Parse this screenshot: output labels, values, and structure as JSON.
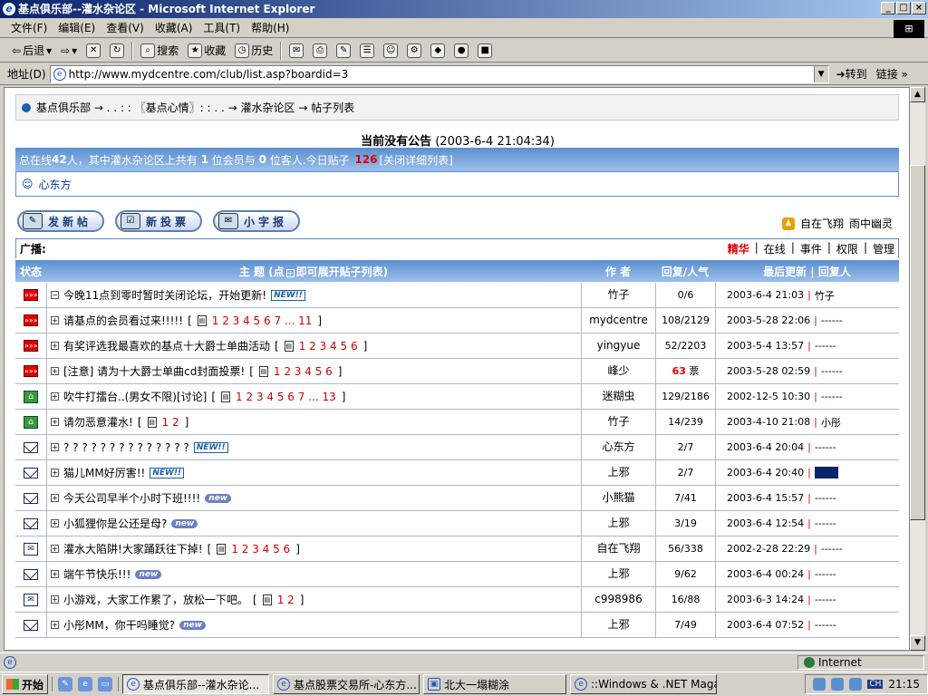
{
  "window": {
    "title": "基点俱乐部--灌水杂论区 - Microsoft Internet Explorer",
    "minimize": "_",
    "maximize": "□",
    "close": "×"
  },
  "menu": [
    "文件(F)",
    "编辑(E)",
    "查看(V)",
    "收藏(A)",
    "工具(T)",
    "帮助(H)"
  ],
  "toolbar": {
    "back": "后退",
    "search": "搜索",
    "favorites": "收藏",
    "history": "历史"
  },
  "address": {
    "label": "地址(D)",
    "url": "http://www.mydcentre.com/club/list.asp?boardid=3",
    "go": "转到",
    "links": "链接"
  },
  "breadcrumb": {
    "text": "基点俱乐部 → . . : : 〖基点心情〗: : . . → 灌水杂论区 → 帖子列表"
  },
  "notice": {
    "title": "当前没有公告",
    "time": "(2003-6-4 21:04:34)"
  },
  "stats": {
    "prefix": "总在线",
    "online": "42",
    "mid1": "人，其中灌水杂论区上共有",
    "members": "1",
    "mid2": "位会员与",
    "guests": "0",
    "mid3": "位客人.今日贴子",
    "today": "126",
    "link": "[关闭详细列表]"
  },
  "online_user": "心东方",
  "buttons": {
    "post": "发新帖",
    "vote": "新投票",
    "note": "小字报"
  },
  "friends": {
    "a": "自在飞翔",
    "b": "雨中幽灵"
  },
  "ad": {
    "label": "广播:",
    "jinghua": "精华",
    "online": "在线",
    "event": "事件",
    "perm": "权限",
    "manage": "管理"
  },
  "table_header": {
    "status": "状态",
    "topic": "主 题 (点",
    "topic2": "即可展开贴子列表)",
    "author": "作 者",
    "replies": "回复/人气",
    "last": "最后更新 | 回复人"
  },
  "threads": [
    {
      "icon": "hot",
      "sign": "⊟",
      "title": "今晚11点到零时暂时关闭论坛，开始更新!",
      "badge": "NEW!!",
      "badgeType": "new1",
      "pages": "",
      "author": "竹子",
      "replies": "0/6",
      "votes": "",
      "last": "2003-6-4 21:03",
      "replier": "竹子"
    },
    {
      "icon": "hot",
      "sign": "⊞",
      "title": "请基点的会员看过来!!!!!",
      "badge": "",
      "badgeType": "",
      "pages": "1 2 3 4 5 6 7 ... 11",
      "author": "mydcentre",
      "replies": "108/2129",
      "votes": "",
      "last": "2003-5-28 22:06",
      "replier": "------"
    },
    {
      "icon": "hot",
      "sign": "⊞",
      "title": "有奖评选我最喜欢的基点十大爵士单曲活动",
      "badge": "",
      "badgeType": "",
      "pages": "1 2 3 4 5 6",
      "author": "yingyue",
      "replies": "52/2203",
      "votes": "",
      "last": "2003-5-4 13:57",
      "replier": "------"
    },
    {
      "icon": "hot",
      "sign": "⊞",
      "title": "[注意] 请为十大爵士单曲cd封面投票!",
      "badge": "",
      "badgeType": "",
      "pages": "1 2 3 4 5 6",
      "author": "峰少",
      "replies": "63",
      "votes": "票",
      "last": "2003-5-28 02:59",
      "replier": "------"
    },
    {
      "icon": "lock",
      "sign": "⊞",
      "title": "吹牛打擂台..(男女不限)[讨论]",
      "badge": "",
      "badgeType": "",
      "pages": "1 2 3 4 5 6 7 ... 13",
      "author": "迷糊虫",
      "replies": "129/2186",
      "votes": "",
      "last": "2002-12-5 10:30",
      "replier": "------"
    },
    {
      "icon": "lock",
      "sign": "⊞",
      "title": "请勿恶意灌水!",
      "badge": "",
      "badgeType": "",
      "pages": "1 2",
      "author": "竹子",
      "replies": "14/239",
      "votes": "",
      "last": "2003-4-10 21:08",
      "replier": "小彤"
    },
    {
      "icon": "mail",
      "sign": "⊞",
      "title": "? ? ? ? ? ? ? ? ? ? ? ? ? ?",
      "badge": "NEW!!",
      "badgeType": "new1",
      "pages": "",
      "author": "心东方",
      "replies": "2/7",
      "votes": "",
      "last": "2003-6-4 20:04",
      "replier": "------"
    },
    {
      "icon": "mail",
      "sign": "⊞",
      "title": "猫儿MM好厉害!!",
      "badge": "NEW!!",
      "badgeType": "new1",
      "pages": "",
      "author": "上邪",
      "replies": "2/7",
      "votes": "",
      "last": "2003-6-4 20:40",
      "replier": "------",
      "highlight": true
    },
    {
      "icon": "mail",
      "sign": "⊞",
      "title": "今天公司早半个小时下班!!!!",
      "badge": "new",
      "badgeType": "new2",
      "pages": "",
      "author": "小熊猫",
      "replies": "7/41",
      "votes": "",
      "last": "2003-6-4 15:57",
      "replier": "------"
    },
    {
      "icon": "mail",
      "sign": "⊞",
      "title": "小狐狸你是公还是母?",
      "badge": "new",
      "badgeType": "new2",
      "pages": "",
      "author": "上邪",
      "replies": "3/19",
      "votes": "",
      "last": "2003-6-4 12:54",
      "replier": "------"
    },
    {
      "icon": "open",
      "sign": "⊞",
      "title": "灌水大陷阱!大家踊跃往下掉!",
      "badge": "",
      "badgeType": "",
      "pages": "1 2 3 4 5 6",
      "author": "自在飞翔",
      "replies": "56/338",
      "votes": "",
      "last": "2002-2-28 22:29",
      "replier": "------"
    },
    {
      "icon": "mail",
      "sign": "⊞",
      "title": "端午节快乐!!!",
      "badge": "new",
      "badgeType": "new2",
      "pages": "",
      "author": "上邪",
      "replies": "9/62",
      "votes": "",
      "last": "2003-6-4 00:24",
      "replier": "------"
    },
    {
      "icon": "open",
      "sign": "⊞",
      "title": "小游戏，大家工作累了，放松一下吧。",
      "badge": "",
      "badgeType": "",
      "pages": "1 2",
      "author": "c998986",
      "replies": "16/88",
      "votes": "",
      "last": "2003-6-3 14:24",
      "replier": "------"
    },
    {
      "icon": "mail",
      "sign": "⊞",
      "title": "小彤MM，你干吗睡觉?",
      "badge": "new",
      "badgeType": "new2",
      "pages": "",
      "author": "上邪",
      "replies": "7/49",
      "votes": "",
      "last": "2003-6-4 07:52",
      "replier": "------"
    }
  ],
  "status": {
    "zone": "Internet"
  },
  "taskbar": {
    "start": "开始",
    "tasks": [
      "基点俱乐部--灌水杂论...",
      "基点股票交易所-心东方...",
      "北大一塌糊涂",
      "::Windows & .NET Magazi..."
    ],
    "tray_lang": "CH",
    "clock": "21:15"
  },
  "colors": {
    "header_blue": "#5b8fd0",
    "red": "#e00000",
    "ie_blue": "#0a246a"
  }
}
